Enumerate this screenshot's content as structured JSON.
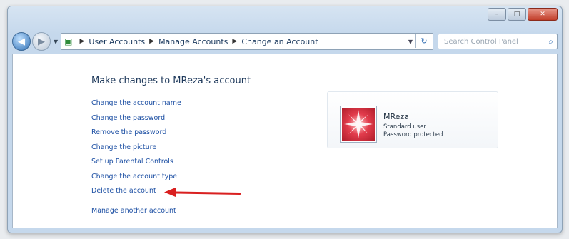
{
  "window": {
    "caption_buttons": {
      "minimize": "–",
      "maximize": "□",
      "close": "✕"
    }
  },
  "navbar": {
    "back_icon": "back-arrow-icon",
    "forward_icon": "forward-arrow-icon",
    "breadcrumbs": [
      "User Accounts",
      "Manage Accounts",
      "Change an Account"
    ],
    "search_placeholder": "Search Control Panel"
  },
  "main": {
    "title": "Make changes to MReza's account",
    "links": [
      "Change the account name",
      "Change the password",
      "Remove the password",
      "Change the picture",
      "Set up Parental Controls",
      "Change the account type",
      "Delete the account"
    ],
    "other_link": "Manage another account"
  },
  "user": {
    "name": "MReza",
    "type": "Standard user",
    "status": "Password protected"
  },
  "annotation": {
    "arrow_color": "#d92020"
  }
}
